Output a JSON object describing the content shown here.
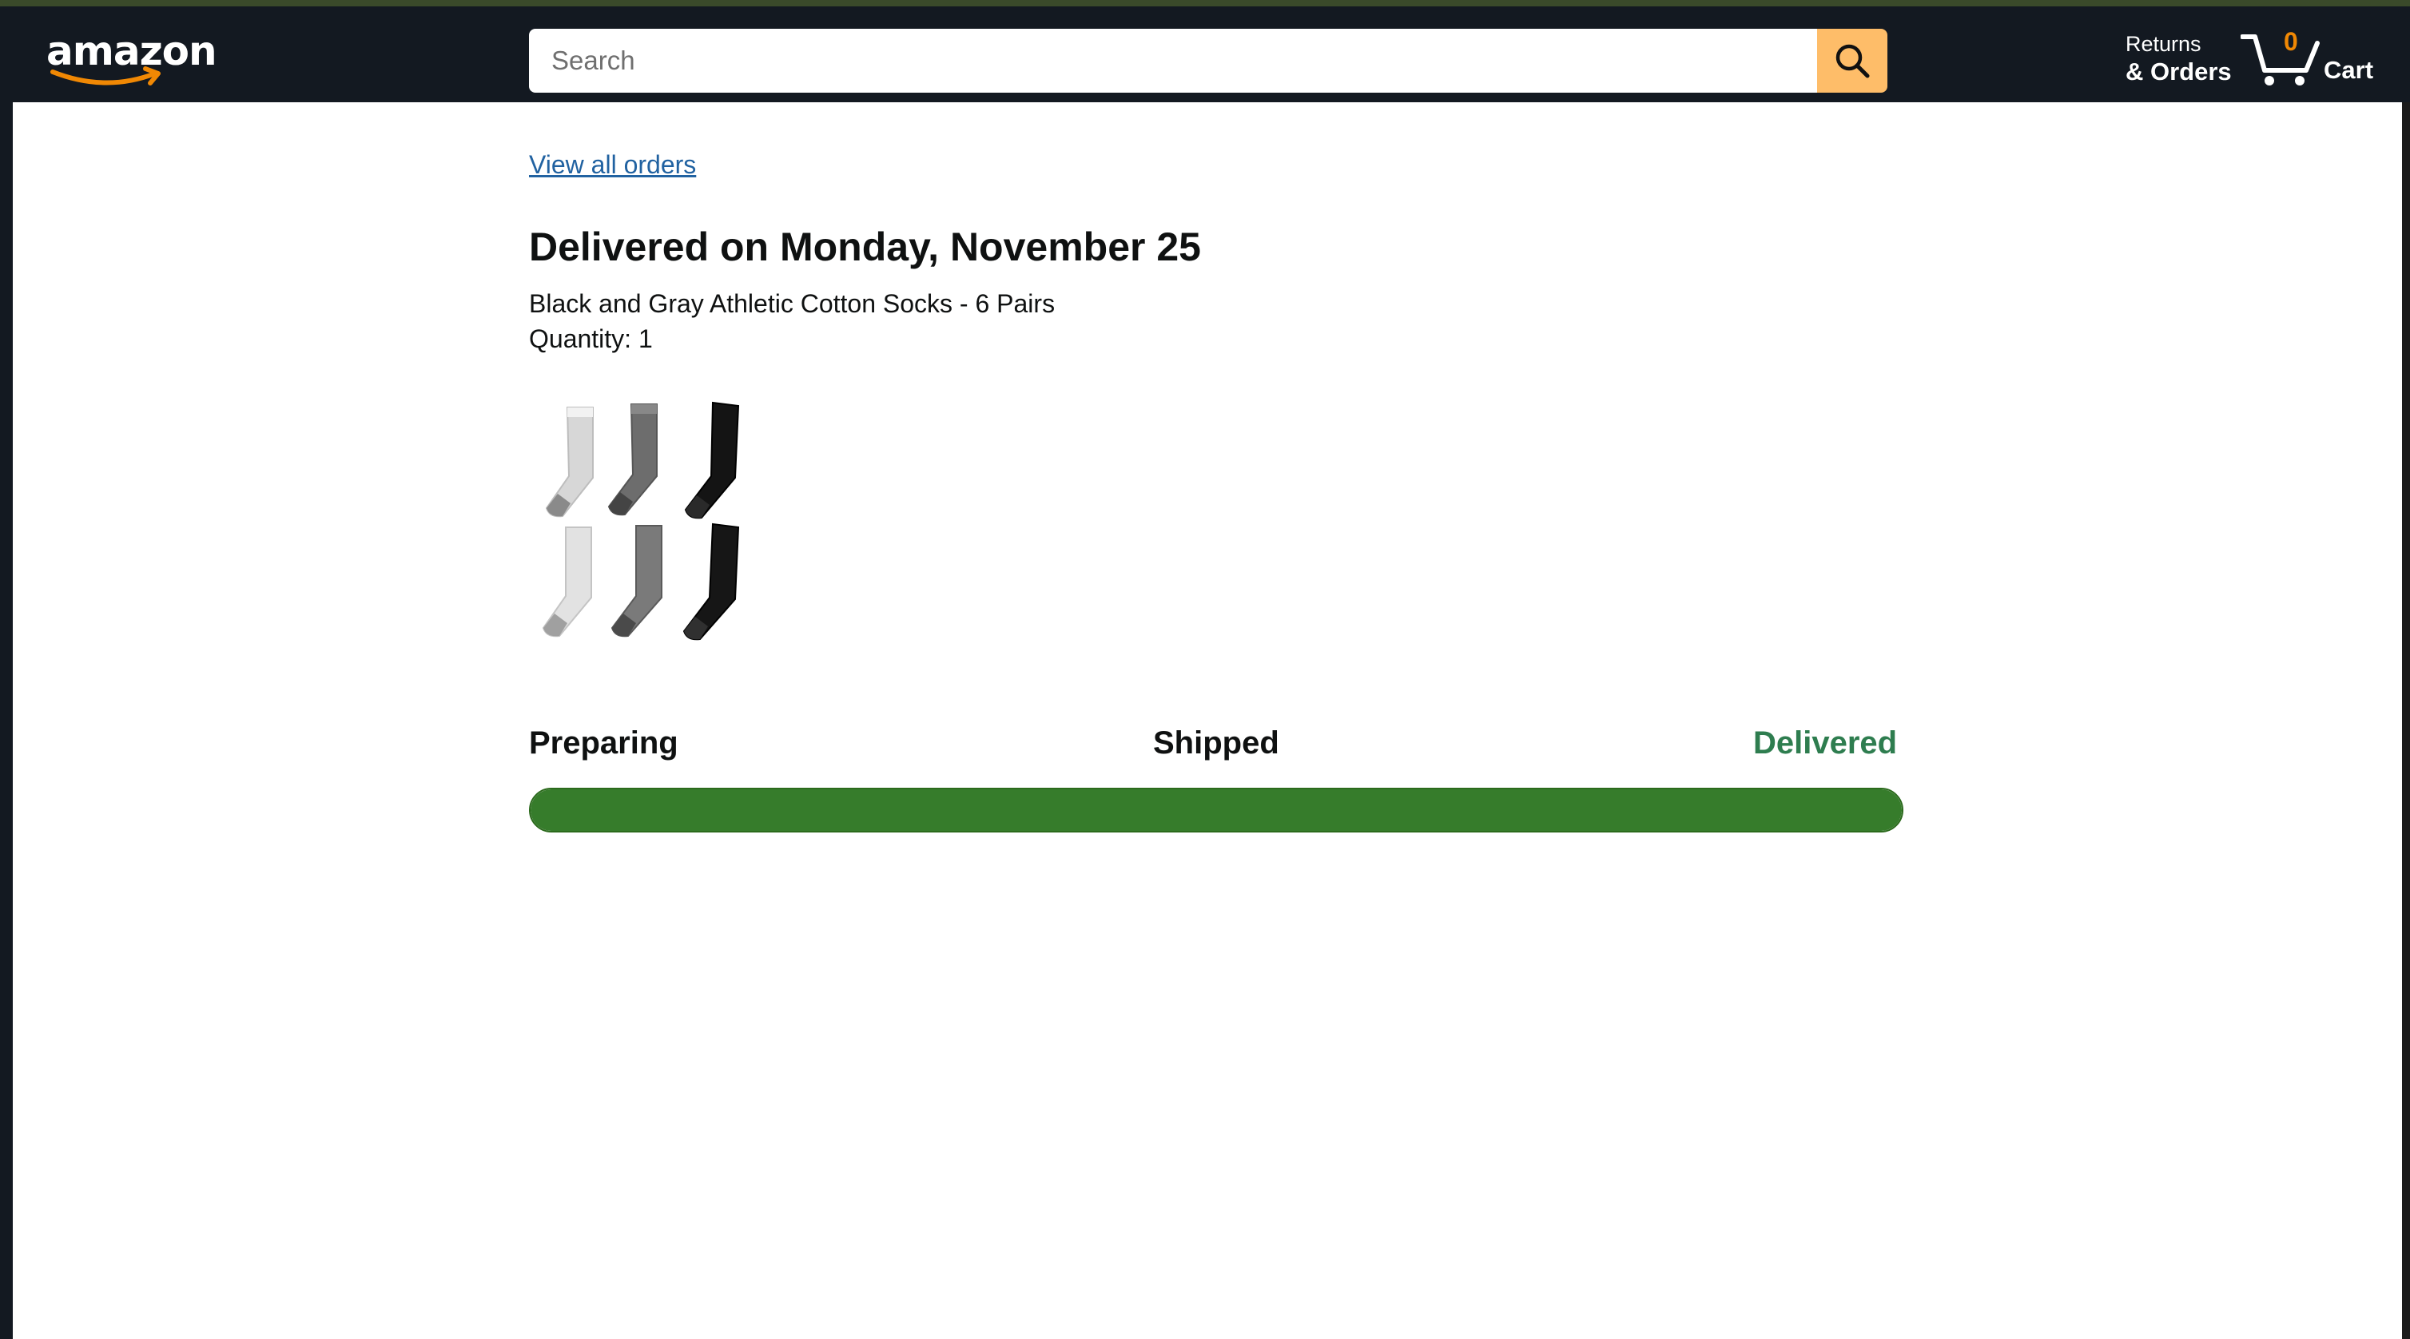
{
  "header": {
    "logo_text": "amazon",
    "search": {
      "placeholder": "Search",
      "value": ""
    },
    "returns_line1": "Returns",
    "returns_line2": "& Orders",
    "cart_count": "0",
    "cart_label": "Cart"
  },
  "order": {
    "view_all_link": "View all orders",
    "status_title": "Delivered on Monday, November 25",
    "product_name": "Black and Gray Athletic Cotton Socks - 6 Pairs",
    "quantity": "Quantity: 1"
  },
  "tracking": {
    "steps": [
      "Preparing",
      "Shipped",
      "Delivered"
    ],
    "progress_fraction": 1.0
  },
  "colors": {
    "header_bg": "#131921",
    "search_button": "#febd69",
    "cart_count": "#f08804",
    "link": "#2162a1",
    "delivered_text": "#2e7d4f",
    "progress_fill": "#367c2b"
  },
  "icons": [
    "search-icon",
    "cart-icon",
    "amazon-smile-icon"
  ]
}
